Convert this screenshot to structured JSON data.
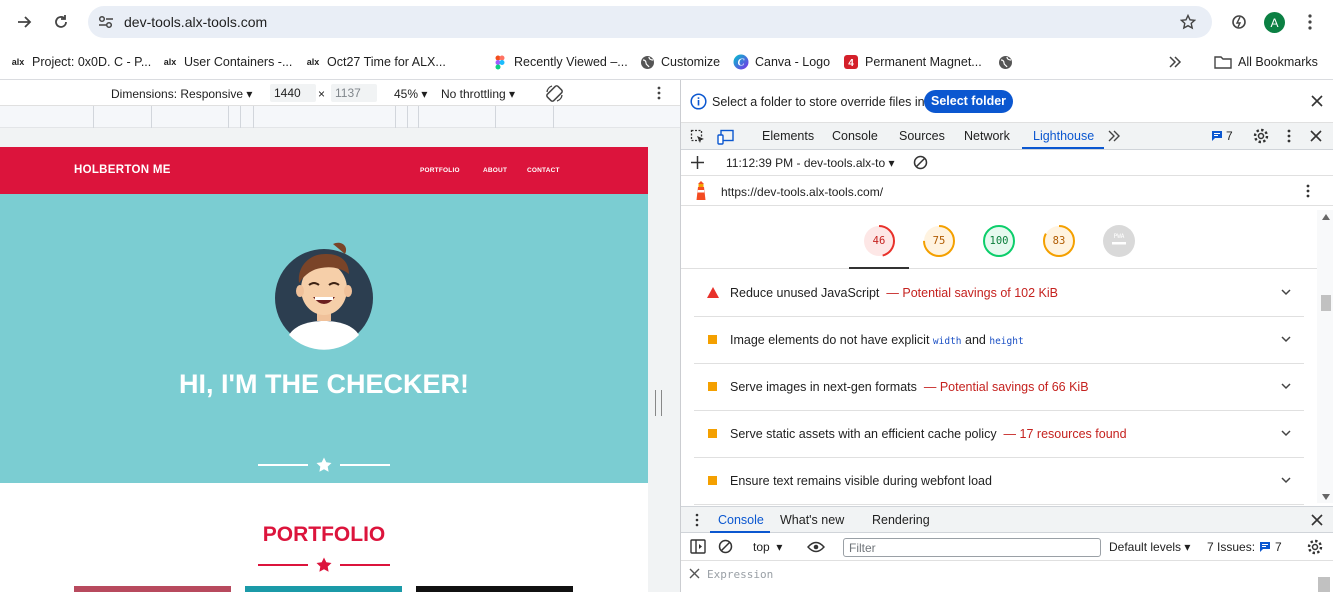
{
  "browser": {
    "url": "dev-tools.alx-tools.com",
    "bookmarks": [
      {
        "label": "Project: 0x0D. C - P...",
        "icon": "alx-icon"
      },
      {
        "label": "User Containers -...",
        "icon": "alx-icon"
      },
      {
        "label": "Oct27 Time for ALX...",
        "icon": "alx-icon"
      },
      {
        "label": "Recently Viewed –...",
        "icon": "figma-icon"
      },
      {
        "label": "Customize",
        "icon": "globe-icon"
      },
      {
        "label": "Canva - Logo",
        "icon": "canva-icon"
      },
      {
        "label": "Permanent Magnet...",
        "icon": "magnet-icon"
      }
    ],
    "all_bookmarks": "All Bookmarks",
    "avatar_letter": "A"
  },
  "device_toolbar": {
    "dimensions_label": "Dimensions: Responsive",
    "width": "1440",
    "times": "×",
    "height": "1137",
    "zoom": "45%",
    "throttling": "No throttling"
  },
  "website": {
    "brand": "HOLBERTON ME",
    "nav": [
      "PORTFOLIO",
      "ABOUT",
      "CONTACT"
    ],
    "hero_title": "HI, I'M THE CHECKER!",
    "section_title": "PORTFOLIO",
    "colors": {
      "primary": "#dc143c",
      "hero": "#7bcdd2"
    }
  },
  "devtools": {
    "info_message": "Select a folder to store override files in.",
    "select_folder": "Select folder",
    "tabs": [
      "Elements",
      "Console",
      "Sources",
      "Network",
      "Lighthouse"
    ],
    "active_tab": "Lighthouse",
    "issues_badge": "7",
    "report_time": "11:12:39 PM - dev-tools.alx-to",
    "report_url": "https://dev-tools.alx-tools.com/",
    "scores": [
      {
        "value": "46",
        "color": "#e8312a",
        "fraction": 0.46
      },
      {
        "value": "75",
        "color": "#f4a000",
        "fraction": 0.75
      },
      {
        "value": "100",
        "color": "#0cce6b",
        "fraction": 1.0
      },
      {
        "value": "83",
        "color": "#f4a000",
        "fraction": 0.83
      },
      {
        "value": "PWA",
        "color": "#cccccc",
        "fraction": 0
      }
    ],
    "audits": [
      {
        "title": "Reduce unused JavaScript",
        "dash": "—",
        "savings": "Potential savings of 102 KiB",
        "severity": "fail"
      },
      {
        "title": "Image elements do not have explicit",
        "code1": "width",
        "and": "and",
        "code2": "height",
        "severity": "average"
      },
      {
        "title": "Serve images in next-gen formats",
        "dash": "—",
        "savings": "Potential savings of 66 KiB",
        "severity": "average"
      },
      {
        "title": "Serve static assets with an efficient cache policy",
        "dash": "—",
        "savings": "17 resources found",
        "severity": "average"
      },
      {
        "title": "Ensure text remains visible during webfont load",
        "severity": "average"
      }
    ],
    "drawer_tabs": [
      "Console",
      "What's new",
      "Rendering"
    ],
    "console": {
      "context": "top",
      "filter_placeholder": "Filter",
      "levels": "Default levels",
      "issues_label": "7 Issues:",
      "issues_count": "7",
      "expression_placeholder": "Expression"
    }
  }
}
